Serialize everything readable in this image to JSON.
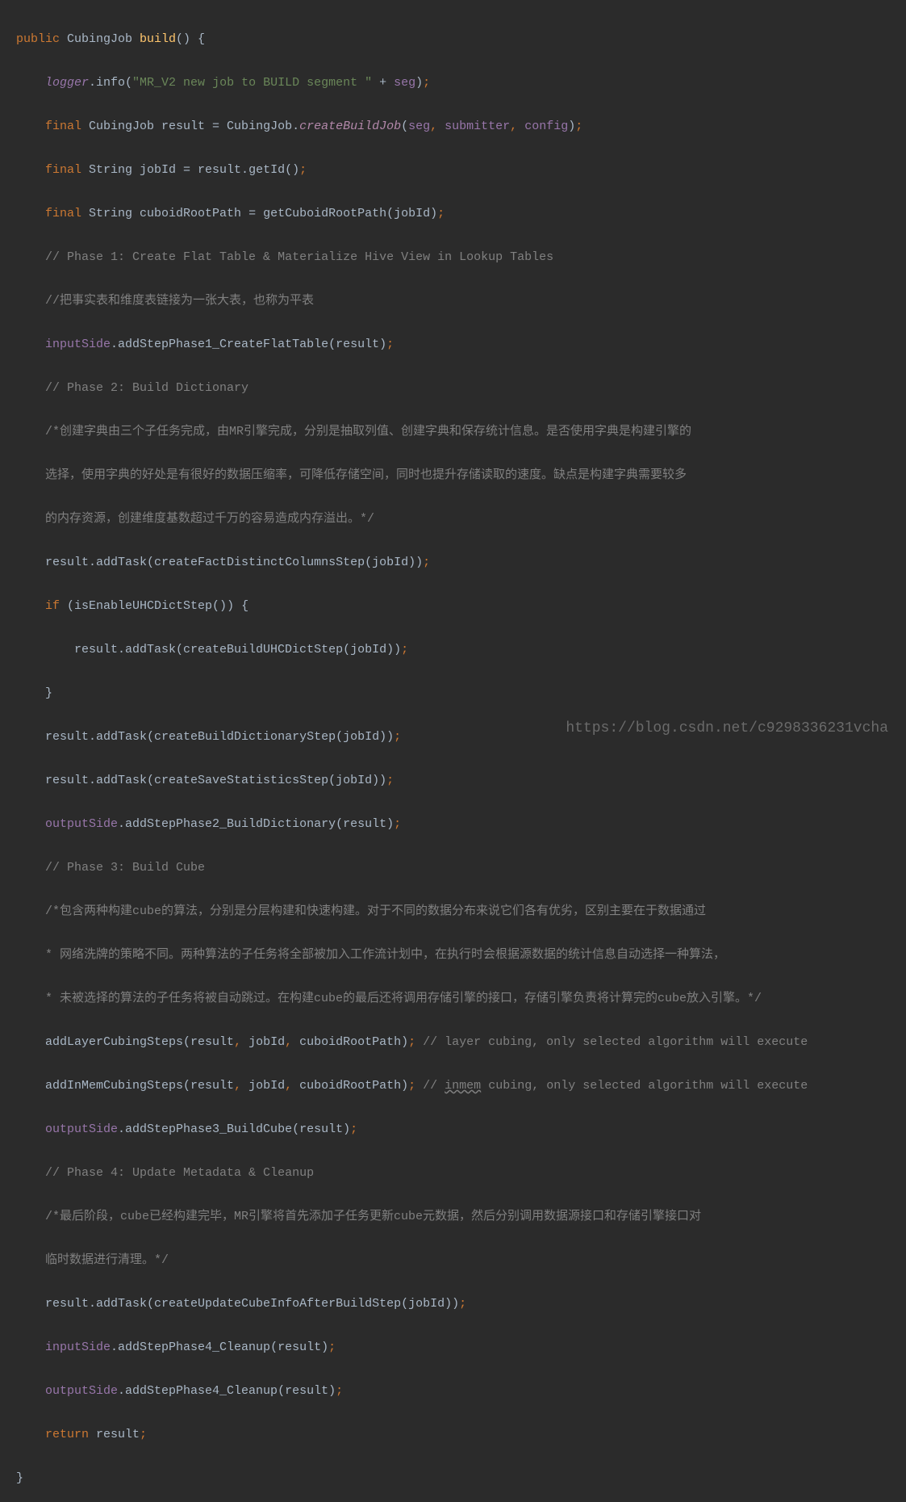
{
  "lines": {
    "l1": {
      "t1": "public ",
      "t2": "CubingJob ",
      "t3": "build",
      "t4": "() {"
    },
    "l2": {
      "t1": "logger",
      "t2": ".info(",
      "t3": "\"MR_V2 new job to BUILD segment \" ",
      "t4": "+ ",
      "t5": "seg",
      "t6": ")",
      "t7": ";"
    },
    "l3": {
      "t1": "final ",
      "t2": "CubingJob result = CubingJob.",
      "t3": "createBuildJob",
      "t4": "(",
      "t5": "seg",
      "t6": ", ",
      "t7": "submitter",
      "t8": ", ",
      "t9": "config",
      "t10": ")",
      "t11": ";"
    },
    "l4": {
      "t1": "final ",
      "t2": "String jobId = result.getId()",
      "t3": ";"
    },
    "l5": {
      "t1": "final ",
      "t2": "String cuboidRootPath = getCuboidRootPath(jobId)",
      "t3": ";"
    },
    "l6": "// Phase 1: Create Flat Table & Materialize Hive View in Lookup Tables",
    "l7": "//把事实表和维度表链接为一张大表，也称为平表",
    "l8": {
      "t1": "inputSide",
      "t2": ".addStepPhase1_CreateFlatTable(result)",
      "t3": ";"
    },
    "l9": "// Phase 2: Build Dictionary",
    "l10": "/*创建字典由三个子任务完成，由MR引擎完成，分别是抽取列值、创建字典和保存统计信息。是否使用字典是构建引擎的",
    "l11": "选择，使用字典的好处是有很好的数据压缩率，可降低存储空间，同时也提升存储读取的速度。缺点是构建字典需要较多",
    "l12": "的内存资源，创建维度基数超过千万的容易造成内存溢出。*/",
    "l13": {
      "t1": "result.addTask(createFactDistinctColumnsStep(jobId))",
      "t2": ";"
    },
    "l14": {
      "t1": "if ",
      "t2": "(isEnableUHCDictStep()) {"
    },
    "l15": {
      "t1": "result.addTask(createBuildUHCDictStep(jobId))",
      "t2": ";"
    },
    "l16": "}",
    "l17": {
      "t1": "result.addTask(createBuildDictionaryStep(jobId))",
      "t2": ";"
    },
    "l18": {
      "t1": "result.addTask(createSaveStatisticsStep(jobId))",
      "t2": ";"
    },
    "l19": {
      "t1": "outputSide",
      "t2": ".addStepPhase2_BuildDictionary(result)",
      "t3": ";"
    },
    "l20": "// Phase 3: Build Cube",
    "l21": "/*包含两种构建cube的算法，分别是分层构建和快速构建。对于不同的数据分布来说它们各有优劣，区别主要在于数据通过",
    "l22": "* 网络洗牌的策略不同。两种算法的子任务将全部被加入工作流计划中，在执行时会根据源数据的统计信息自动选择一种算法，",
    "l23": "* 未被选择的算法的子任务将被自动跳过。在构建cube的最后还将调用存储引擎的接口，存储引擎负责将计算完的cube放入引擎。*/",
    "l24": {
      "t1": "addLayerCubingSteps(result",
      "t2": ", ",
      "t3": "jobId",
      "t4": ", ",
      "t5": "cuboidRootPath)",
      "t6": "; ",
      "t7": "// layer cubing, only selected algorithm will execute"
    },
    "l25": {
      "t1": "addInMemCubingSteps(result",
      "t2": ", ",
      "t3": "jobId",
      "t4": ", ",
      "t5": "cuboidRootPath)",
      "t6": "; ",
      "t7a": "// ",
      "t7b": "inmem",
      "t7c": " cubing, only selected algorithm will execute"
    },
    "l26": {
      "t1": "outputSide",
      "t2": ".addStepPhase3_BuildCube(result)",
      "t3": ";"
    },
    "l27": "// Phase 4: Update Metadata & Cleanup",
    "l28": "/*最后阶段，cube已经构建完毕，MR引擎将首先添加子任务更新cube元数据，然后分别调用数据源接口和存储引擎接口对",
    "l29": "临时数据进行清理。*/",
    "l30": {
      "t1": "result.addTask(createUpdateCubeInfoAfterBuildStep(jobId))",
      "t2": ";"
    },
    "l31": {
      "t1": "inputSide",
      "t2": ".addStepPhase4_Cleanup(result)",
      "t3": ";"
    },
    "l32": {
      "t1": "outputSide",
      "t2": ".addStepPhase4_Cleanup(result)",
      "t3": ";"
    },
    "l33": {
      "t1": "return ",
      "t2": "result",
      "t3": ";"
    },
    "l34": "}"
  },
  "watermark": "https://blog.csdn.net/c9298336231vcha",
  "indent1": "    ",
  "indent2": "        "
}
